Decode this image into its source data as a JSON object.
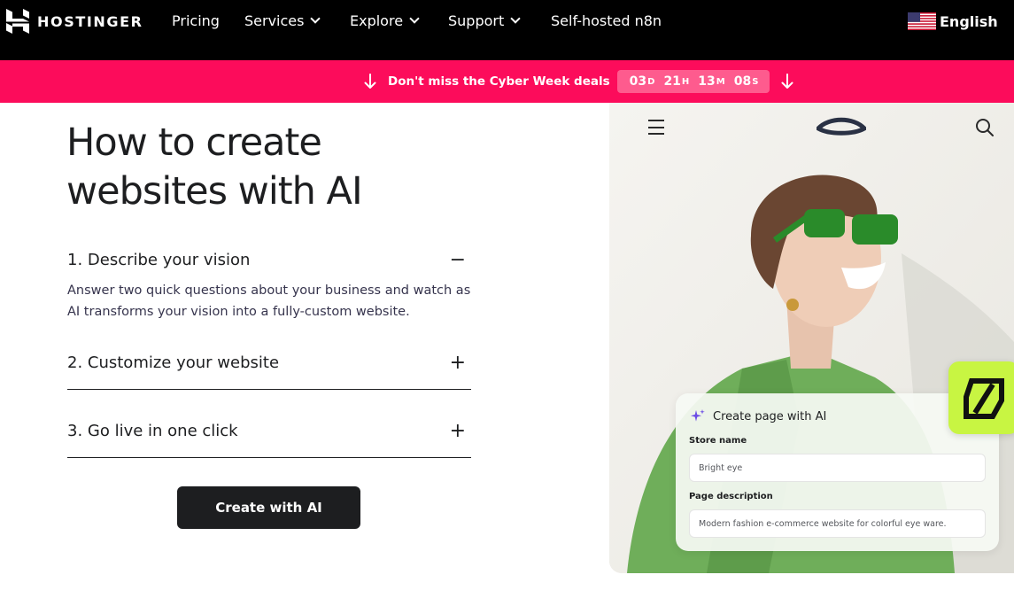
{
  "nav": {
    "brand": "HOSTINGER",
    "items": [
      {
        "label": "Pricing",
        "has_dropdown": false
      },
      {
        "label": "Services",
        "has_dropdown": true
      },
      {
        "label": "Explore",
        "has_dropdown": true
      },
      {
        "label": "Support",
        "has_dropdown": true
      },
      {
        "label": "Self-hosted n8n",
        "has_dropdown": false
      }
    ],
    "language": "English",
    "language_flag_icon": "us-flag-icon"
  },
  "promo": {
    "text": "Don't miss the Cyber Week deals",
    "timer": {
      "days": "03",
      "days_unit": "D",
      "hours": "21",
      "hours_unit": "H",
      "minutes": "13",
      "minutes_unit": "M",
      "seconds": "08",
      "seconds_unit": "S"
    },
    "background": "#fc0c5b"
  },
  "main": {
    "heading": "How to create websites with AI",
    "steps": [
      {
        "title": "1. Describe your vision",
        "toggle": "−",
        "expanded": true,
        "description": "Answer two quick questions about your business and watch as AI transforms your vision into a fully-custom website."
      },
      {
        "title": "2. Customize your website",
        "toggle": "+",
        "expanded": false
      },
      {
        "title": "3. Go live in one click",
        "toggle": "+",
        "expanded": false
      }
    ],
    "cta_label": "Create with AI"
  },
  "preview": {
    "card_title": "Create page with AI",
    "store_name_label": "Store name",
    "store_name_value": "Bright eye",
    "page_description_label": "Page description",
    "page_description_value": "Modern fashion e-commerce website for colorful eye ware.",
    "accent": "#c8f542"
  }
}
